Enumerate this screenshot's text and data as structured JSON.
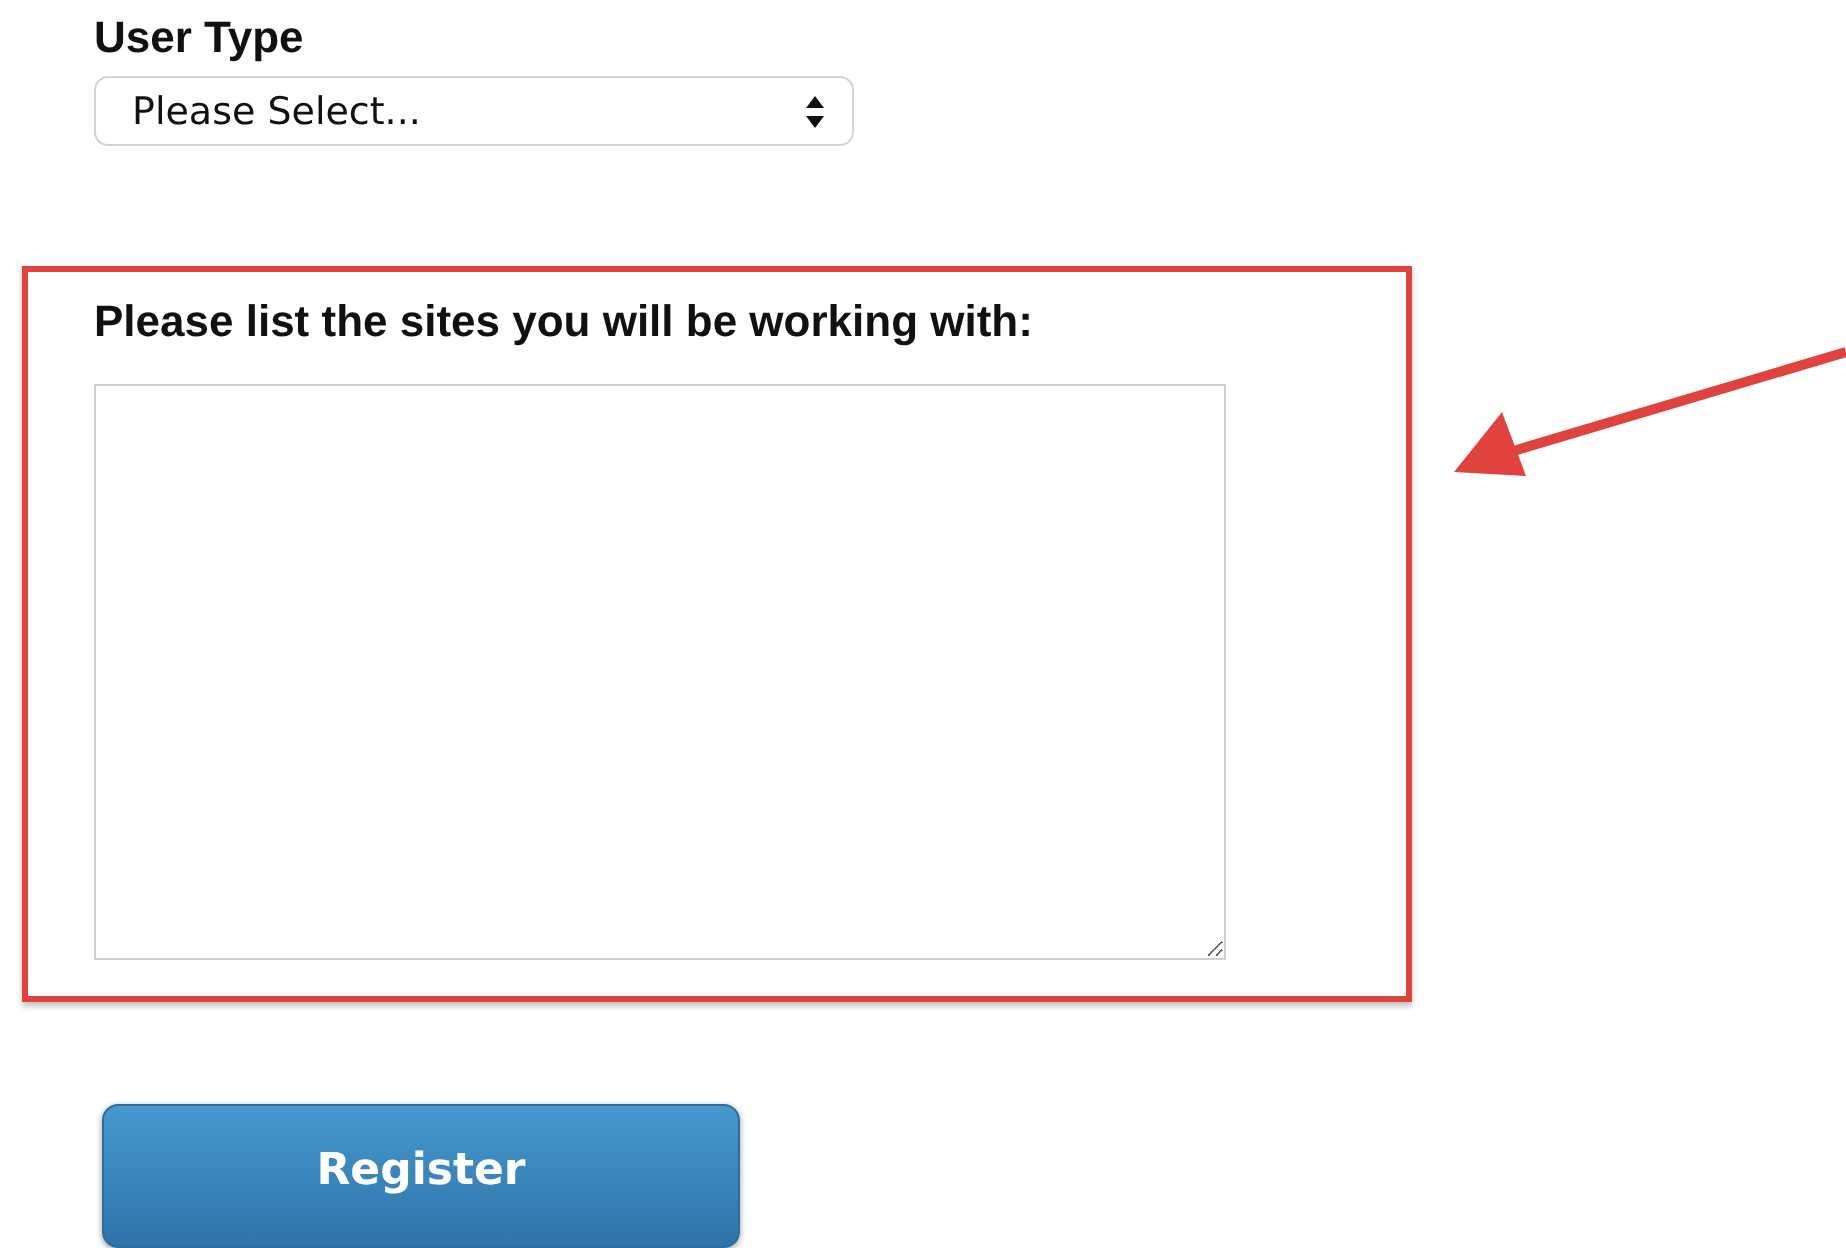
{
  "user_type": {
    "label": "User Type",
    "value": "Please Select..."
  },
  "sites": {
    "label": "Please list the sites you will be working with:",
    "highlighted": true
  },
  "register_button": {
    "label": "Register"
  }
}
